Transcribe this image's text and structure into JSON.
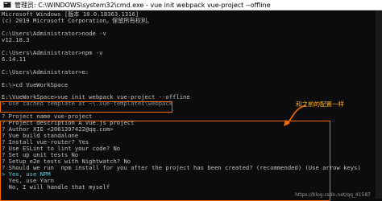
{
  "window": {
    "title": "管理员: C:\\WINDOWS\\system32\\cmd.exe - vue  init webpack vue-project --offline"
  },
  "console": {
    "lines": [
      "Microsoft Windows [版本 10.0.18363.1316]",
      "(c) 2019 Microsoft Corporation。保留所有权利。",
      "",
      "C:\\Users\\Administrator>node -v",
      "v12.18.3",
      "",
      "C:\\Users\\Administrator>npm -v",
      "6.14.11",
      "",
      "C:\\Users\\Administrator>e:",
      "",
      "E:\\>cd VueWorkSpace",
      "",
      "E:\\VueWorkSpace>vue init webpack vue-project --offline",
      "> Use cached template at ~\\.vue-templates\\webpack",
      "",
      "? Project name vue-project",
      "? Project description A Vue.js project",
      "? Author XIE <2061397422@qq.com>",
      "? Vue build standalone",
      "? Install vue-router? Yes",
      "? Use ESLint to lint your code? No",
      "? Set up unit tests No",
      "? Setup e2e tests with Nightwatch? No",
      "? Should we run  npm install for you after the project has been created? (recommended) (Use arrow keys)",
      "> Yes, use NPM",
      "  Yes, use Yarn",
      "  No, I will handle that myself"
    ]
  },
  "annotation": {
    "text": "和之前的配置一样"
  },
  "watermark": "https://blog.csdn.net/qq_41587"
}
